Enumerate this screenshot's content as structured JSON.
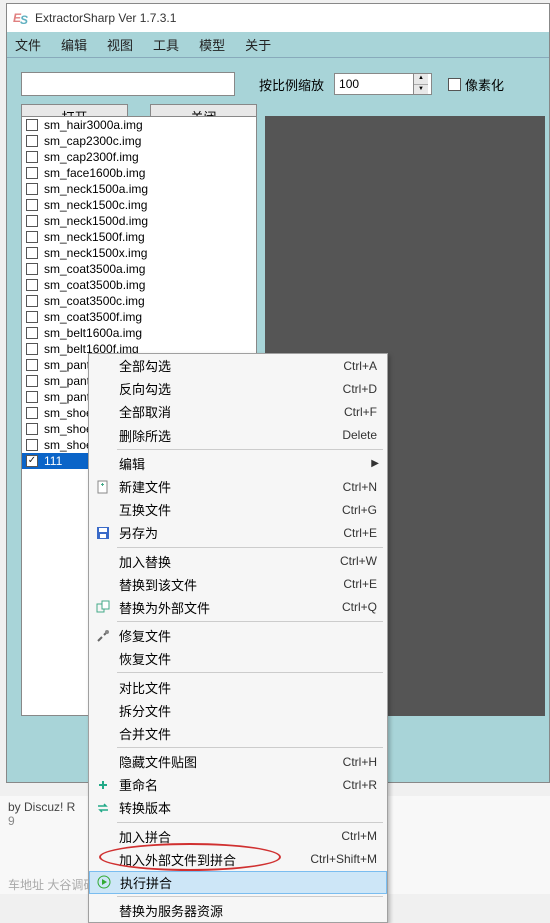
{
  "title": "ExtractorSharp Ver 1.7.3.1",
  "menubar": [
    "文件",
    "编辑",
    "视图",
    "工具",
    "模型",
    "关于"
  ],
  "path_value": "",
  "buttons": {
    "open": "打开",
    "close": "关闭"
  },
  "zoom": {
    "label": "按比例缩放",
    "value": "100"
  },
  "pixelate_label": "像素化",
  "list": [
    {
      "name": "sm_hair3000a.img",
      "checked": false
    },
    {
      "name": "sm_cap2300c.img",
      "checked": false
    },
    {
      "name": "sm_cap2300f.img",
      "checked": false
    },
    {
      "name": "sm_face1600b.img",
      "checked": false
    },
    {
      "name": "sm_neck1500a.img",
      "checked": false
    },
    {
      "name": "sm_neck1500c.img",
      "checked": false
    },
    {
      "name": "sm_neck1500d.img",
      "checked": false
    },
    {
      "name": "sm_neck1500f.img",
      "checked": false
    },
    {
      "name": "sm_neck1500x.img",
      "checked": false
    },
    {
      "name": "sm_coat3500a.img",
      "checked": false
    },
    {
      "name": "sm_coat3500b.img",
      "checked": false
    },
    {
      "name": "sm_coat3500c.img",
      "checked": false
    },
    {
      "name": "sm_coat3500f.img",
      "checked": false
    },
    {
      "name": "sm_belt1600a.img",
      "checked": false
    },
    {
      "name": "sm_belt1600f.img",
      "checked": false
    },
    {
      "name": "sm_pants",
      "checked": false
    },
    {
      "name": "sm_pants",
      "checked": false
    },
    {
      "name": "sm_pants",
      "checked": false
    },
    {
      "name": "sm_shoes",
      "checked": false
    },
    {
      "name": "sm_shoes",
      "checked": false
    },
    {
      "name": "sm_shoes",
      "checked": false
    },
    {
      "name": "111",
      "checked": true,
      "selected": true
    }
  ],
  "context_menu": [
    {
      "type": "item",
      "label": "全部勾选",
      "shortcut": "Ctrl+A"
    },
    {
      "type": "item",
      "label": "反向勾选",
      "shortcut": "Ctrl+D"
    },
    {
      "type": "item",
      "label": "全部取消",
      "shortcut": "Ctrl+F"
    },
    {
      "type": "item",
      "label": "删除所选",
      "shortcut": "Delete"
    },
    {
      "type": "sep"
    },
    {
      "type": "item",
      "label": "编辑",
      "submenu": true
    },
    {
      "type": "item",
      "label": "新建文件",
      "shortcut": "Ctrl+N",
      "icon": "new-file"
    },
    {
      "type": "item",
      "label": "互换文件",
      "shortcut": "Ctrl+G"
    },
    {
      "type": "item",
      "label": "另存为",
      "shortcut": "Ctrl+E",
      "icon": "save"
    },
    {
      "type": "sep"
    },
    {
      "type": "item",
      "label": "加入替换",
      "shortcut": "Ctrl+W"
    },
    {
      "type": "item",
      "label": "替换到该文件",
      "shortcut": "Ctrl+E"
    },
    {
      "type": "item",
      "label": "替换为外部文件",
      "shortcut": "Ctrl+Q",
      "icon": "replace"
    },
    {
      "type": "sep"
    },
    {
      "type": "item",
      "label": "修复文件",
      "icon": "repair"
    },
    {
      "type": "item",
      "label": "恢复文件"
    },
    {
      "type": "sep"
    },
    {
      "type": "item",
      "label": "对比文件"
    },
    {
      "type": "item",
      "label": "拆分文件"
    },
    {
      "type": "item",
      "label": "合并文件"
    },
    {
      "type": "sep"
    },
    {
      "type": "item",
      "label": "隐藏文件贴图",
      "shortcut": "Ctrl+H"
    },
    {
      "type": "item",
      "label": "重命名",
      "shortcut": "Ctrl+R",
      "icon": "rename"
    },
    {
      "type": "item",
      "label": "转换版本",
      "icon": "convert"
    },
    {
      "type": "sep"
    },
    {
      "type": "item",
      "label": "加入拼合",
      "shortcut": "Ctrl+M"
    },
    {
      "type": "item",
      "label": "加入外部文件到拼合",
      "shortcut": "Ctrl+Shift+M"
    },
    {
      "type": "item",
      "label": "执行拼合",
      "highlight": true,
      "icon": "run"
    },
    {
      "type": "sep"
    },
    {
      "type": "item",
      "label": "替换为服务器资源"
    }
  ],
  "footer": {
    "line1": "by Discuz! R",
    "line2": "9",
    "line3": "车地址   大谷调研"
  }
}
